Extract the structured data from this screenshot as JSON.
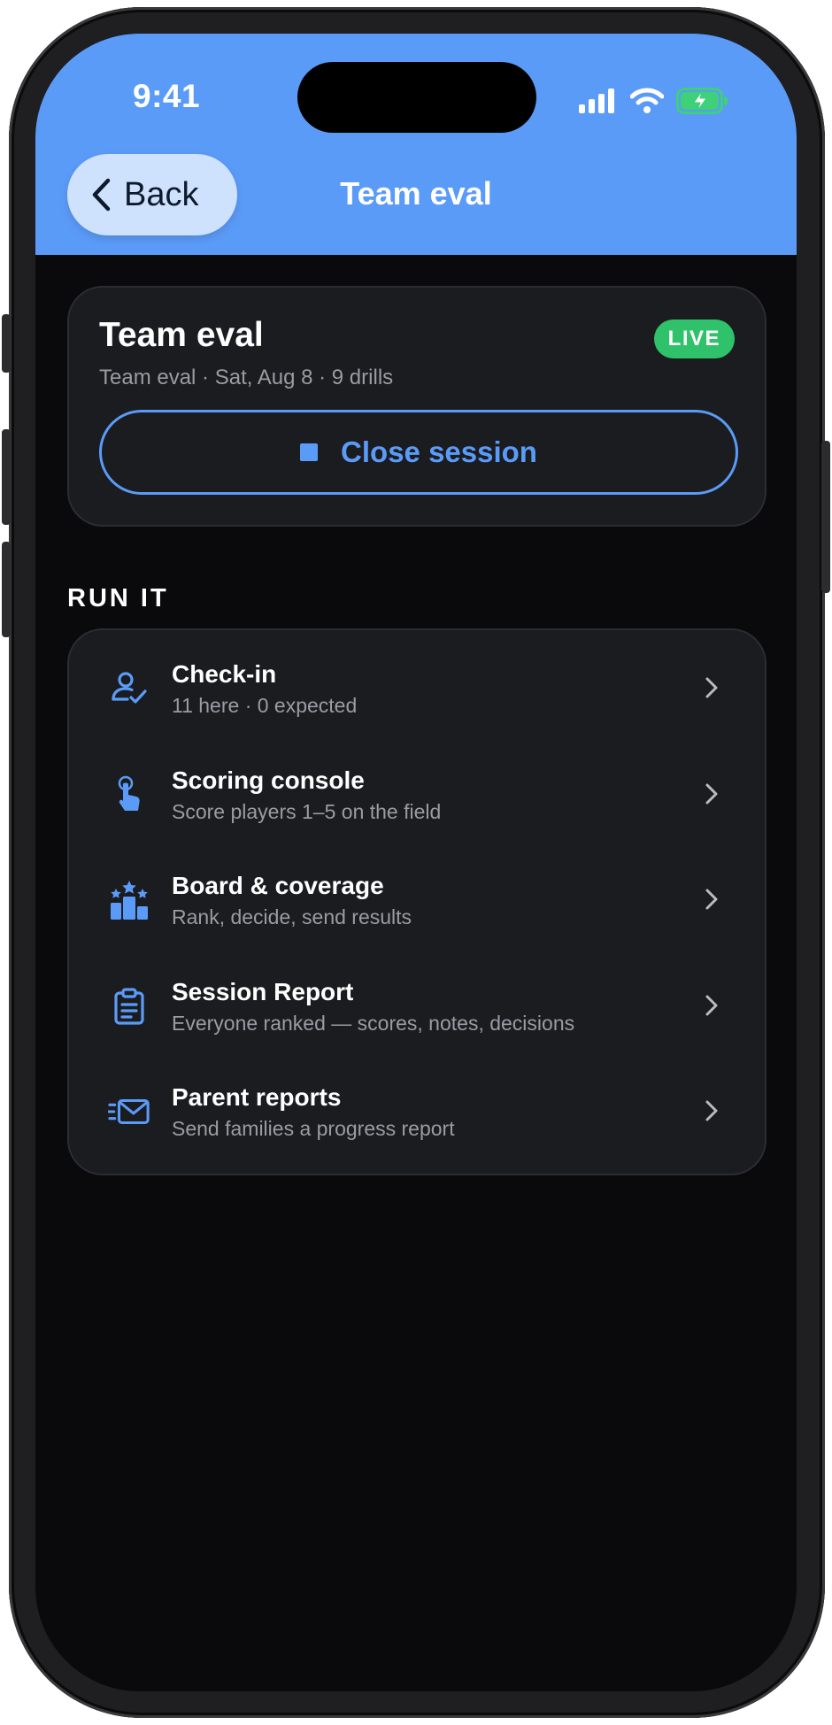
{
  "status_bar": {
    "time": "9:41"
  },
  "nav": {
    "back_label": "Back",
    "title": "Team eval"
  },
  "session": {
    "title": "Team eval",
    "meta": "Team eval · Sat, Aug 8 · 9 drills",
    "badge": "LIVE",
    "close_label": "Close session"
  },
  "section": {
    "heading": "RUN IT"
  },
  "items": [
    {
      "title": "Check-in",
      "subtitle": "11 here · 0 expected",
      "icon": "user-check-icon"
    },
    {
      "title": "Scoring console",
      "subtitle": "Score players 1–5 on the field",
      "icon": "tap-hand-icon"
    },
    {
      "title": "Board & coverage",
      "subtitle": "Rank, decide, send results",
      "icon": "podium-stars-icon"
    },
    {
      "title": "Session Report",
      "subtitle": "Everyone ranked — scores, notes, decisions",
      "icon": "clipboard-icon"
    },
    {
      "title": "Parent reports",
      "subtitle": "Send families a progress report",
      "icon": "send-mail-icon"
    }
  ],
  "colors": {
    "accent": "#5b9bf8",
    "header_bg": "#5b9bf8",
    "live": "#2fc26a",
    "card_bg": "#1b1c20",
    "screen_bg": "#0a0a0c"
  }
}
